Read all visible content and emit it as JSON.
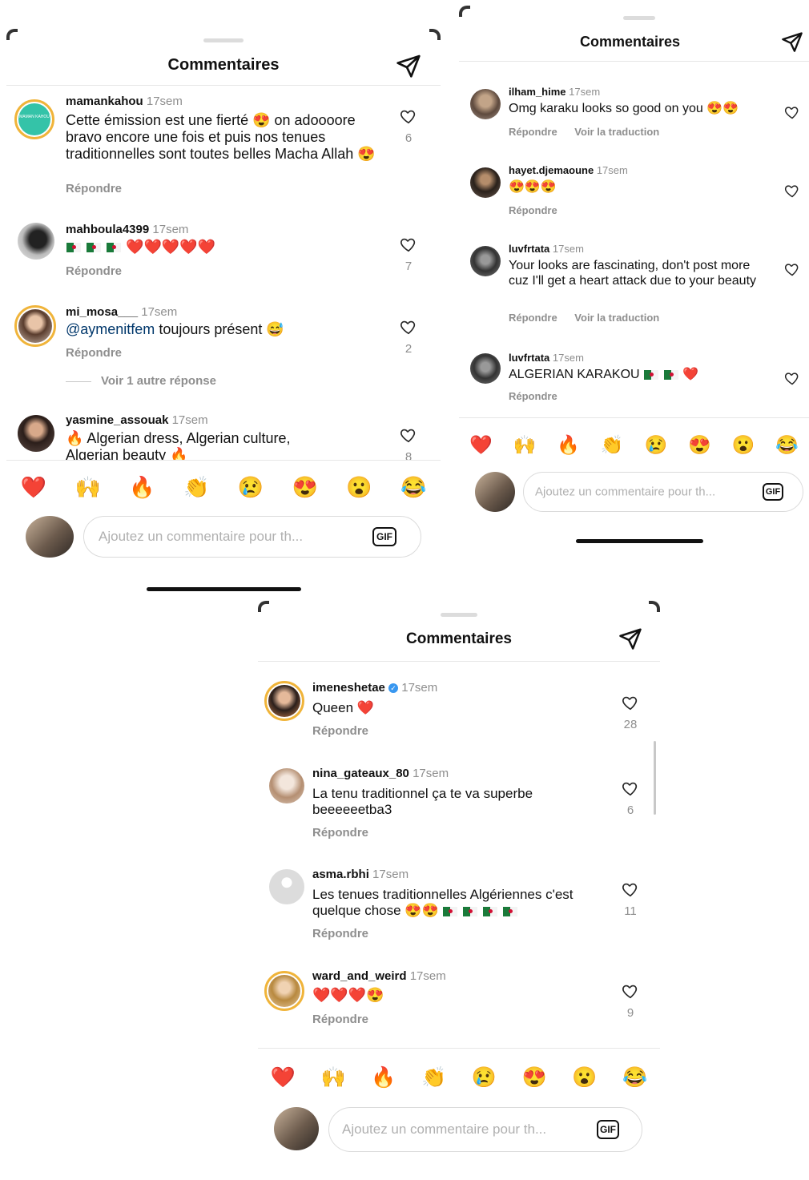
{
  "panel_title": "Commentaires",
  "emoji_bar": [
    "❤️",
    "🙌",
    "🔥",
    "👏",
    "😢",
    "😍",
    "😮",
    "😂"
  ],
  "input_placeholder": "Ajoutez un commentaire pour th...",
  "gif_label": "GIF",
  "reply_label": "Répondre",
  "translate_label": "Voir la traduction",
  "panels": [
    {
      "comments": [
        {
          "user": "mamankahou",
          "time": "17sem",
          "text": "Cette émission est une fierté 😍 on adoooore bravo encore une fois et puis nos tenues traditionnelles sont toutes belles Macha Allah 😍",
          "likes": "6",
          "avatar_text": "MAMAN KAHOU"
        },
        {
          "user": "mahboula4399",
          "time": "17sem",
          "text_flags": 3,
          "text": "❤️❤️❤️❤️❤️",
          "likes": "7"
        },
        {
          "user": "mi_mosa___",
          "time": "17sem",
          "mention": "@aymenitfem",
          "text": "toujours présent 😅",
          "likes": "2",
          "more_replies": "Voir 1 autre réponse"
        },
        {
          "user": "yasmine_assouak",
          "time": "17sem",
          "text": "🔥 Algerian dress, Algerian culture, Algerian beauty 🔥",
          "likes": "8"
        }
      ]
    },
    {
      "comments": [
        {
          "user": "ilham_hime",
          "time": "17sem",
          "text": "Omg karaku looks so good on you 😍😍"
        },
        {
          "user": "hayet.djemaoune",
          "time": "17sem",
          "text": "😍😍😍"
        },
        {
          "user": "luvfrtata",
          "time": "17sem",
          "text": "Your looks are fascinating, don't post more cuz I'll get a heart attack due to your beauty"
        },
        {
          "user": "luvfrtata",
          "time": "17sem",
          "text": "ALGERIAN KARAKOU",
          "text_after": "❤️"
        }
      ]
    },
    {
      "comments": [
        {
          "user": "imeneshetae",
          "time": "17sem",
          "text": "Queen ❤️",
          "likes": "28"
        },
        {
          "user": "nina_gateaux_80",
          "time": "17sem",
          "text": "La tenu traditionnel ça te va superbe beeeeeetba3",
          "likes": "6"
        },
        {
          "user": "asma.rbhi",
          "time": "17sem",
          "text": "Les tenues traditionnelles Algériennes c'est quelque chose 😍😍",
          "likes": "11"
        },
        {
          "user": "ward_and_weird",
          "time": "17sem",
          "text": "❤️❤️❤️😍",
          "likes": "9"
        }
      ]
    }
  ],
  "colors": {
    "story_ring": "#f0b43a",
    "secondary_text": "#8e8e8e",
    "verified": "#3897f0",
    "mention": "#00376b"
  }
}
